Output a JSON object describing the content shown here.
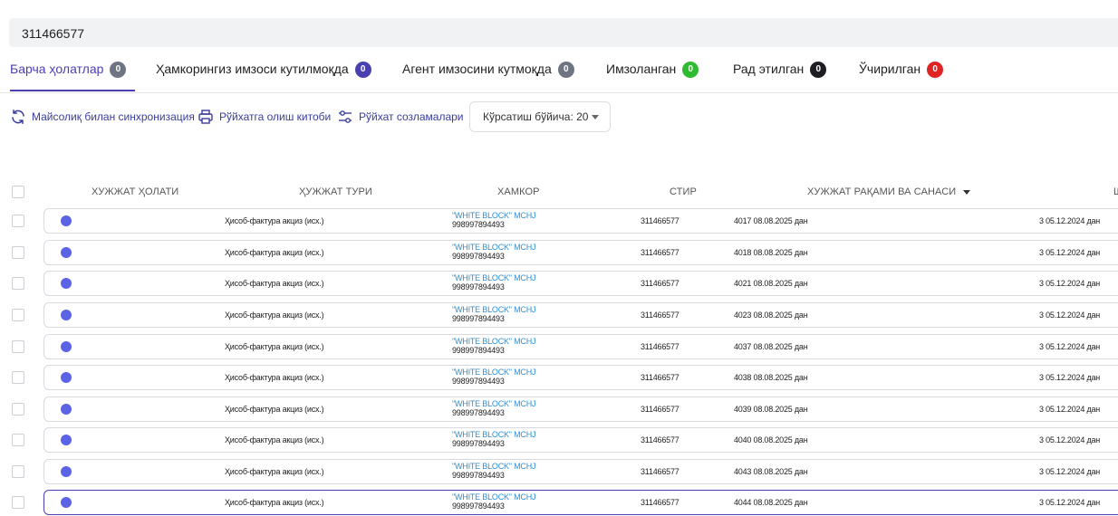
{
  "search": {
    "value": "311466577"
  },
  "tabs": [
    {
      "label": "Барча ҳолатлар",
      "count": "0",
      "color": "#6f7483"
    },
    {
      "label": "Ҳамкорингиз имзоси кутилмоқда",
      "count": "0",
      "color": "#4a3fb0"
    },
    {
      "label": "Агент имзосини кутмоқда",
      "count": "0",
      "color": "#6f7483"
    },
    {
      "label": "Имзоланган",
      "count": "0",
      "color": "#2fbb2f"
    },
    {
      "label": "Рад этилган",
      "count": "0",
      "color": "#1d1d22"
    },
    {
      "label": "Ўчирилган",
      "count": "0",
      "color": "#e02424"
    }
  ],
  "toolbar": {
    "sync_label": "Майсолиқ билан синхронизация",
    "print_label": "Рўйхатга олиш китоби",
    "settings_label": "Рўйхат созламалари",
    "page_size_label": "Кўрсатиш бўйича: 20"
  },
  "columns": {
    "status": "ХУЖЖАТ ҲОЛАТИ",
    "type": "ҲУЖЖАТ ТУРИ",
    "partner": "ХАМКОР",
    "tin": "СТИР",
    "doc_number_date": "ХУЖЖАТ РАҚАМИ ВА САНАСИ",
    "contract": "Ш"
  },
  "rows": [
    {
      "type": "Ҳисоб-фактура акциз (исх.)",
      "partner_name": "\"WHITE BLOCK\" MCHJ",
      "partner_tin": "998997894493",
      "tin": "311466577",
      "doc": "4017 08.08.2025 дан",
      "contract": "3 05.12.2024 дан"
    },
    {
      "type": "Ҳисоб-фактура акциз (исх.)",
      "partner_name": "\"WHITE BLOCK\" MCHJ",
      "partner_tin": "998997894493",
      "tin": "311466577",
      "doc": "4018 08.08.2025 дан",
      "contract": "3 05.12.2024 дан"
    },
    {
      "type": "Ҳисоб-фактура акциз (исх.)",
      "partner_name": "\"WHITE BLOCK\" MCHJ",
      "partner_tin": "998997894493",
      "tin": "311466577",
      "doc": "4021 08.08.2025 дан",
      "contract": "3 05.12.2024 дан"
    },
    {
      "type": "Ҳисоб-фактура акциз (исх.)",
      "partner_name": "\"WHITE BLOCK\" MCHJ",
      "partner_tin": "998997894493",
      "tin": "311466577",
      "doc": "4023 08.08.2025 дан",
      "contract": "3 05.12.2024 дан"
    },
    {
      "type": "Ҳисоб-фактура акциз (исх.)",
      "partner_name": "\"WHITE BLOCK\" MCHJ",
      "partner_tin": "998997894493",
      "tin": "311466577",
      "doc": "4037 08.08.2025 дан",
      "contract": "3 05.12.2024 дан"
    },
    {
      "type": "Ҳисоб-фактура акциз (исх.)",
      "partner_name": "\"WHITE BLOCK\" MCHJ",
      "partner_tin": "998997894493",
      "tin": "311466577",
      "doc": "4038 08.08.2025 дан",
      "contract": "3 05.12.2024 дан"
    },
    {
      "type": "Ҳисоб-фактура акциз (исх.)",
      "partner_name": "\"WHITE BLOCK\" MCHJ",
      "partner_tin": "998997894493",
      "tin": "311466577",
      "doc": "4039 08.08.2025 дан",
      "contract": "3 05.12.2024 дан"
    },
    {
      "type": "Ҳисоб-фактура акциз (исх.)",
      "partner_name": "\"WHITE BLOCK\" MCHJ",
      "partner_tin": "998997894493",
      "tin": "311466577",
      "doc": "4040 08.08.2025 дан",
      "contract": "3 05.12.2024 дан"
    },
    {
      "type": "Ҳисоб-фактура акциз (исх.)",
      "partner_name": "\"WHITE BLOCK\" MCHJ",
      "partner_tin": "998997894493",
      "tin": "311466577",
      "doc": "4043 08.08.2025 дан",
      "contract": "3 05.12.2024 дан"
    },
    {
      "type": "Ҳисоб-фактура акциз (исх.)",
      "partner_name": "\"WHITE BLOCK\" MCHJ",
      "partner_tin": "998997894493",
      "tin": "311466577",
      "doc": "4044 08.08.2025 дан",
      "contract": "3 05.12.2024 дан"
    }
  ],
  "colors": {
    "accent": "#4b3fb5",
    "status_dot": "#5b63e6",
    "link": "#2a8fd6"
  }
}
